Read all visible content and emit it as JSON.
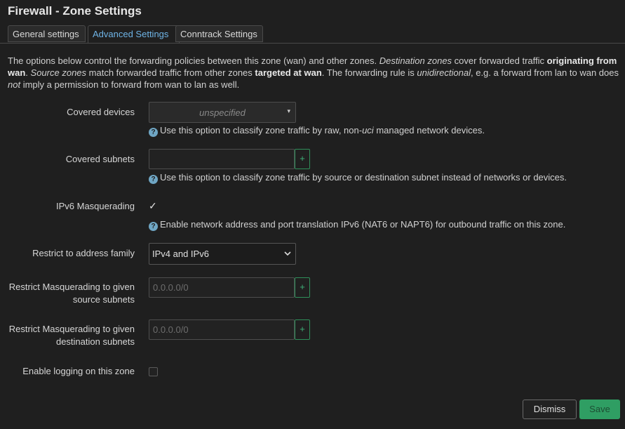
{
  "title": "Firewall - Zone Settings",
  "tabs": [
    "General settings",
    "Advanced Settings",
    "Conntrack Settings"
  ],
  "description": {
    "p1": "The options below control the forwarding policies between this zone (wan) and other zones. ",
    "p2": "Destination zones",
    "p3": " cover forwarded traffic ",
    "p4": "originating from wan",
    "p5": ". ",
    "p6": "Source zones",
    "p7": " match forwarded traffic from other zones ",
    "p8": "targeted at wan",
    "p9": ". The forwarding rule is ",
    "p10": "unidirectional",
    "p11": ", e.g. a forward from lan to wan does ",
    "p12": "not",
    "p13": " imply a permission to forward from wan to lan as well."
  },
  "covered_devices": {
    "label": "Covered devices",
    "value": "unspecified",
    "help_a": "Use this option to classify zone traffic by raw, non-",
    "help_b": "uci",
    "help_c": " managed network devices."
  },
  "covered_subnets": {
    "label": "Covered subnets",
    "value": "",
    "help": "Use this option to classify zone traffic by source or destination subnet instead of networks or devices."
  },
  "ipv6_masq": {
    "label": "IPv6 Masquerading",
    "checked": true,
    "help": "Enable network address and port translation IPv6 (NAT6 or NAPT6) for outbound traffic on this zone."
  },
  "address_family": {
    "label": "Restrict to address family",
    "value": "IPv4 and IPv6"
  },
  "masq_src": {
    "label_line1": "Restrict Masquerading to given",
    "label_line2": "source subnets",
    "placeholder": "0.0.0.0/0"
  },
  "masq_dest": {
    "label_line1": "Restrict Masquerading to given",
    "label_line2": "destination subnets",
    "placeholder": "0.0.0.0/0"
  },
  "logging": {
    "label": "Enable logging on this zone",
    "checked": false
  },
  "buttons": {
    "dismiss": "Dismiss",
    "save": "Save"
  },
  "icons": {
    "help": "?",
    "plus": "+",
    "check": "✓",
    "dropdown_small": "▾"
  },
  "colors": {
    "accent_tab": "#6fb4e6",
    "save_bg": "#2f9e63",
    "plus_border": "#2f8f5a"
  }
}
